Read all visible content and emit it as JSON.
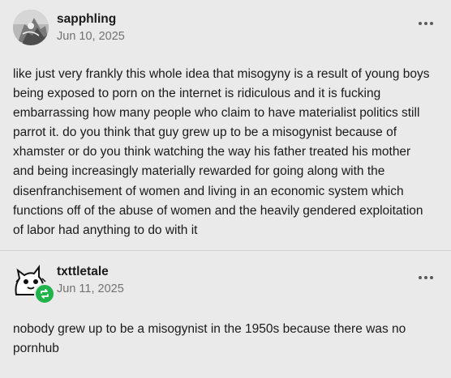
{
  "posts": [
    {
      "username": "sapphling",
      "date": "Jun 10, 2025",
      "avatar_icon": "avatar-icon",
      "more_icon": "more-options-icon",
      "text": "like just very frankly this whole idea that misogyny is a result of young boys being exposed to porn on the internet is ridiculous and it is fucking embarrassing how many people who claim to have materialist politics still parrot it. do you think that guy grew up to be a misogynist because of xhamster or do you think watching the way his father treated his mother and being increasingly materially rewarded for going along with the disenfranchisement of women and living in an economic system which functions off of the abuse of women and the heavily gendered exploitation of labor had anything to do with it"
    },
    {
      "username": "txttletale",
      "date": "Jun 11, 2025",
      "avatar_icon": "avatar-icon",
      "badge_icon": "reblog-icon",
      "more_icon": "more-options-icon",
      "text": "nobody grew up to be a misogynist in the 1950s because there was no pornhub"
    }
  ],
  "colors": {
    "background": "#eaeaea",
    "text": "#1a1a1a",
    "muted": "#727272",
    "badge": "#21b34b"
  }
}
